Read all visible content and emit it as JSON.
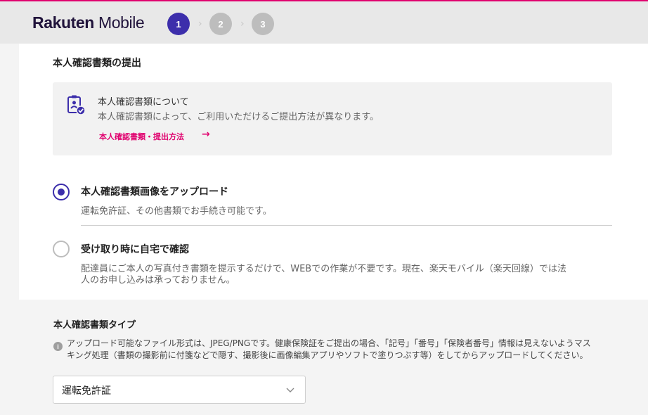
{
  "header": {
    "logo_bold": "Rakuten",
    "logo_light": " Mobile",
    "steps": [
      "1",
      "2",
      "3"
    ],
    "active_step": "1"
  },
  "section": {
    "title": "本人確認書類の提出"
  },
  "info_box": {
    "icon": "id-document-check-icon",
    "title": "本人確認書類について",
    "description": "本人確認書類によって、ご利用いただけるご提出方法が異なります。",
    "link_label": "本人確認書類・提出方法",
    "link_arrow": "→"
  },
  "options": [
    {
      "title": "本人確認書類画像をアップロード",
      "description_lines": [
        "運転免許証、その他書類でお手続き可能です。"
      ],
      "selected": true
    },
    {
      "title": "受け取り時に自宅で確認",
      "description_lines": [
        "配達員にご本人の写真付き書類を提示するだけで、WEBでの作業が不要です。現在、楽天モバイル（楽天回線）では法",
        "人のお申し込みは承っておりません。"
      ],
      "selected": false
    }
  ],
  "doc_type": {
    "title": "本人確認書類タイプ",
    "info_glyph": "i",
    "note_lines": [
      "アップロード可能なファイル形式は、JPEG/PNGです。健康保険証をご提出の場合、「記号」「番号」「保険者番号」情報は見えないようマス",
      "キング処理（書類の撮影前に付箋などで隠す、撮影後に画像編集アプリやソフトで塗りつぶす等）をしてからアップロードしてください。"
    ],
    "selected_value": "運転免許証"
  },
  "colors": {
    "brand": "#3c2eab",
    "accent": "#e0006e",
    "inactive_step": "#bdbdbd"
  }
}
